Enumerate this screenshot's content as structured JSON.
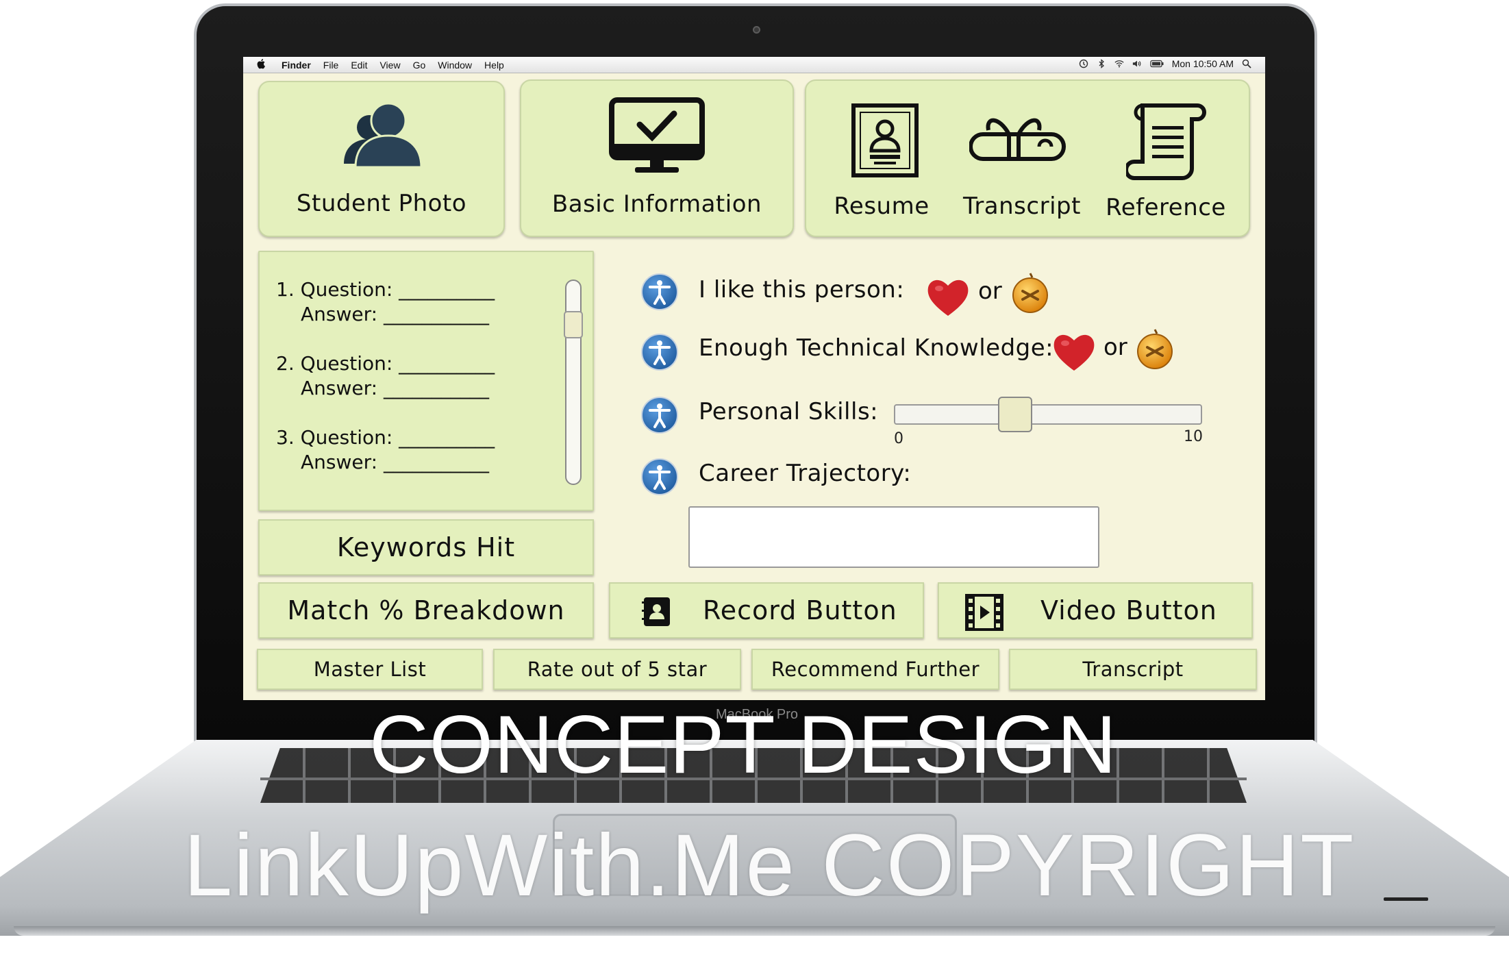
{
  "menubar": {
    "items": [
      "Finder",
      "File",
      "Edit",
      "View",
      "Go",
      "Window",
      "Help"
    ],
    "clock": "Mon 10:50 AM"
  },
  "bezel_label": "MacBook Pro",
  "top_cards": {
    "student_photo": "Student Photo",
    "basic_information": "Basic Information",
    "resume": "Resume",
    "transcript": "Transcript",
    "reference": "Reference"
  },
  "questions": [
    {
      "q": "1. Question: __________",
      "a": "Answer: ___________"
    },
    {
      "q": "2. Question: __________",
      "a": "Answer: ___________"
    },
    {
      "q": "3. Question: __________",
      "a": "Answer: ___________"
    }
  ],
  "form": {
    "like_label": "I like this person:",
    "technical_label": "Enough Technical Knowledge:",
    "or": "or",
    "skills_label": "Personal Skills:",
    "skills_min": "0",
    "skills_max": "10",
    "skills_value_fraction": 0.38,
    "career_label": "Career Trajectory:",
    "career_value": ""
  },
  "buttons": {
    "keywords_hit": "Keywords Hit",
    "match_breakdown": "Match % Breakdown",
    "record": "Record Button",
    "video": "Video Button",
    "master_list": "Master List",
    "rate": "Rate out of 5 star",
    "recommend": "Recommend Further",
    "transcript": "Transcript"
  },
  "colors": {
    "card_bg": "#e4f0bd",
    "screen_bg": "#f6f4dc",
    "heart": "#d2232a",
    "orb": "#f0a318",
    "accessibility_icon": "#2f6fb3"
  },
  "watermark": {
    "line1": "CONCEPT DESIGN",
    "line2": "LinkUpWith.Me COPYRIGHT"
  }
}
